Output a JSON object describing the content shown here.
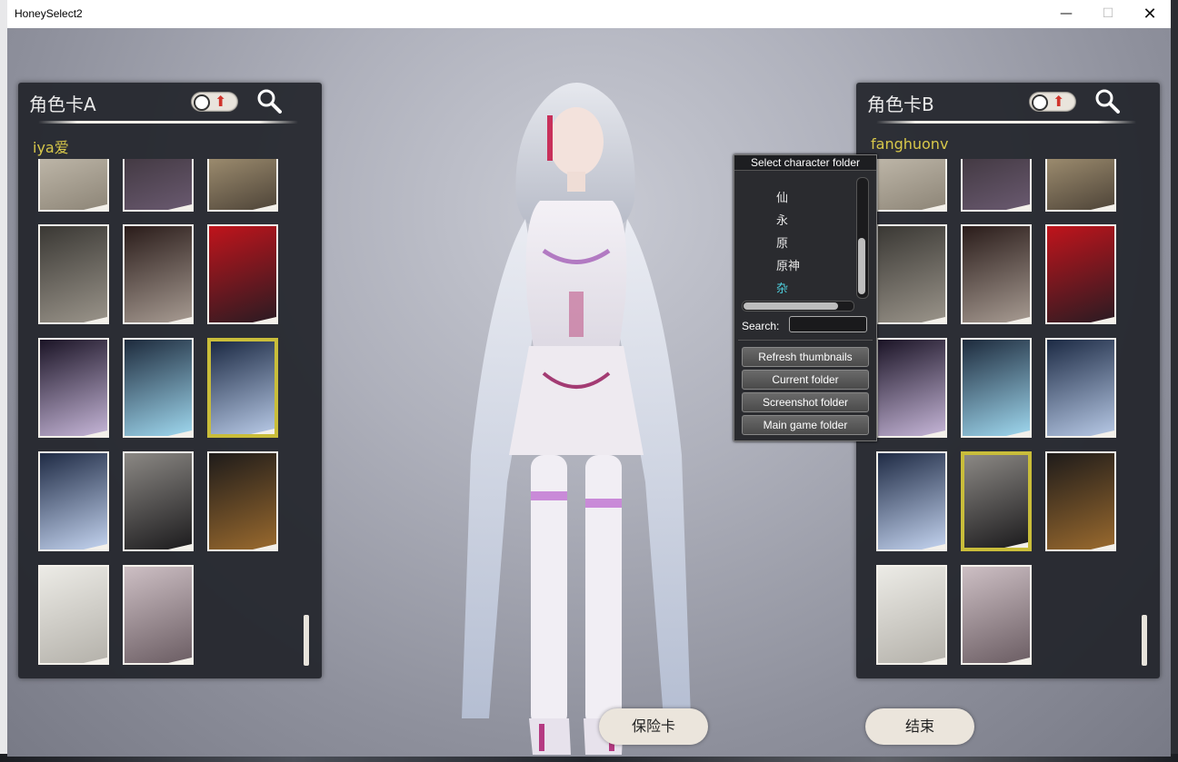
{
  "window": {
    "title": "HoneySelect2",
    "minimize": "—",
    "maximize": "☐",
    "close": "✕"
  },
  "panel_a": {
    "title": "角色卡A",
    "folder": "iya爱",
    "thumbnails": [
      {
        "colors": [
          "#d9d2c4",
          "#8d8577"
        ],
        "selected": false
      },
      {
        "colors": [
          "#2c2628",
          "#6a5a70"
        ],
        "selected": false
      },
      {
        "colors": [
          "#c9b58e",
          "#4e4438"
        ],
        "selected": false
      },
      {
        "colors": [
          "#3a3834",
          "#9a948a"
        ],
        "selected": false
      },
      {
        "colors": [
          "#2a1c1a",
          "#a79b92"
        ],
        "selected": false
      },
      {
        "colors": [
          "#c0141c",
          "#2a1b22"
        ],
        "selected": false
      },
      {
        "colors": [
          "#1b1426",
          "#c6b6d8"
        ],
        "selected": false
      },
      {
        "colors": [
          "#1d2a3c",
          "#9fd8ef"
        ],
        "selected": false
      },
      {
        "colors": [
          "#1c2a44",
          "#b7c9e6"
        ],
        "selected": true
      },
      {
        "colors": [
          "#1f2b45",
          "#c3d3ef"
        ],
        "selected": false
      },
      {
        "colors": [
          "#8b8884",
          "#1c1b1d"
        ],
        "selected": false
      },
      {
        "colors": [
          "#1e1b1a",
          "#9a6a2e"
        ],
        "selected": false
      },
      {
        "colors": [
          "#ecebe6",
          "#b4b1aa"
        ],
        "selected": false
      },
      {
        "colors": [
          "#cdbfc4",
          "#6b5d63"
        ],
        "selected": false
      }
    ]
  },
  "panel_b": {
    "title": "角色卡B",
    "folder": "fanghuonv",
    "thumbnails": [
      {
        "colors": [
          "#d9d2c4",
          "#8d8577"
        ],
        "selected": false
      },
      {
        "colors": [
          "#2c2628",
          "#6a5a70"
        ],
        "selected": false
      },
      {
        "colors": [
          "#c9b58e",
          "#4e4438"
        ],
        "selected": false
      },
      {
        "colors": [
          "#3a3834",
          "#9a948a"
        ],
        "selected": false
      },
      {
        "colors": [
          "#2a1c1a",
          "#a79b92"
        ],
        "selected": false
      },
      {
        "colors": [
          "#c0141c",
          "#2a1b22"
        ],
        "selected": false
      },
      {
        "colors": [
          "#1b1426",
          "#c6b6d8"
        ],
        "selected": false
      },
      {
        "colors": [
          "#1d2a3c",
          "#9fd8ef"
        ],
        "selected": false
      },
      {
        "colors": [
          "#1c2a44",
          "#b7c9e6"
        ],
        "selected": false
      },
      {
        "colors": [
          "#1f2b45",
          "#c3d3ef"
        ],
        "selected": false
      },
      {
        "colors": [
          "#8b8884",
          "#1c1b1d"
        ],
        "selected": true
      },
      {
        "colors": [
          "#1e1b1a",
          "#9a6a2e"
        ],
        "selected": false
      },
      {
        "colors": [
          "#ecebe6",
          "#b4b1aa"
        ],
        "selected": false
      },
      {
        "colors": [
          "#cdbfc4",
          "#6b5d63"
        ],
        "selected": false
      }
    ]
  },
  "dialog": {
    "title": "Select character folder",
    "folders": [
      {
        "label": "仙",
        "active": false
      },
      {
        "label": "永",
        "active": false
      },
      {
        "label": "原",
        "active": false
      },
      {
        "label": "原神",
        "active": false
      },
      {
        "label": "杂",
        "active": true
      }
    ],
    "search_label": "Search:",
    "search_value": "",
    "buttons": {
      "refresh": "Refresh thumbnails",
      "current": "Current folder",
      "screenshot": "Screenshot folder",
      "main": "Main game folder"
    }
  },
  "bottom": {
    "insure_label": "保险卡",
    "end_label": "结束"
  },
  "colors": {
    "selected_border": "#c9bd3a",
    "folder_name": "#d8c84a",
    "active_folder": "#4fd2e0"
  }
}
